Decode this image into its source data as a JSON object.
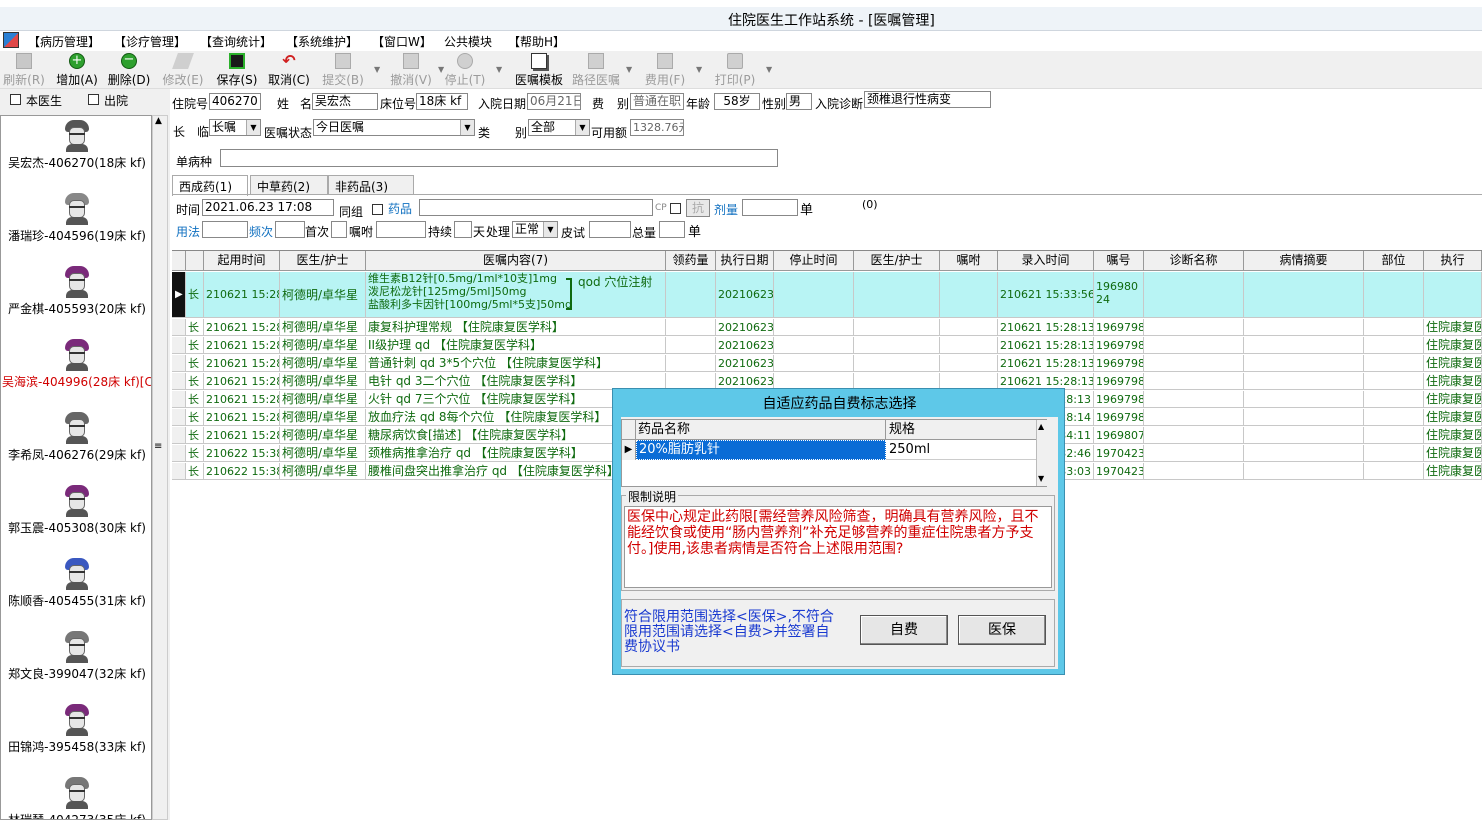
{
  "window": {
    "title": "住院医生工作站系统 - [医嘱管理]"
  },
  "menu": [
    "【病历管理】",
    "【诊疗管理】",
    "【查询统计】",
    "【系统维护】",
    "【窗口W】",
    "公共模块",
    "【帮助H】"
  ],
  "toolbar": [
    {
      "label": "刷新(R)",
      "enabled": false
    },
    {
      "label": "增加(A)",
      "enabled": true
    },
    {
      "label": "删除(D)",
      "enabled": true
    },
    {
      "label": "修改(E)",
      "enabled": false
    },
    {
      "label": "保存(S)",
      "enabled": true
    },
    {
      "label": "取消(C)",
      "enabled": true
    },
    {
      "label": "提交(B)",
      "enabled": false
    },
    {
      "label": "撤消(V)",
      "enabled": false
    },
    {
      "label": "停止(T)",
      "enabled": false
    },
    {
      "label": "医嘱模板",
      "enabled": true
    },
    {
      "label": "路径医嘱",
      "enabled": false
    },
    {
      "label": "费用(F)",
      "enabled": false
    },
    {
      "label": "打印(P)",
      "enabled": false
    }
  ],
  "left": {
    "filter_doctor": "本医生",
    "filter_discharge": "出院",
    "patients": [
      {
        "name": "吴宏杰-406270(18床 kf)",
        "highlight": false
      },
      {
        "name": "潘瑞珍-404596(19床 kf)",
        "highlight": false
      },
      {
        "name": "严金棋-405593(20床 kf)",
        "highlight": false
      },
      {
        "name": "吴海滨-404996(28床 kf)[CE",
        "highlight": true
      },
      {
        "name": "李希凤-406276(29床 kf)",
        "highlight": false
      },
      {
        "name": "郭玉震-405308(30床 kf)",
        "highlight": false
      },
      {
        "name": "陈顺香-405455(31床 kf)",
        "highlight": false
      },
      {
        "name": "郑文良-399047(32床 kf)",
        "highlight": false
      },
      {
        "name": "田锦鸿-395458(33床 kf)",
        "highlight": false
      },
      {
        "name": "林瑞琴-404273(35床 kf)",
        "highlight": false
      }
    ]
  },
  "patient": {
    "id_label": "住院号",
    "id": "406270",
    "name_label1": "姓",
    "name_label2": "名",
    "name": "吴宏杰",
    "bed_label": "床位号",
    "bed": "18床 kf",
    "admit_label": "入院日期",
    "admit": "06月21日",
    "fee_label1": "费",
    "fee_label2": "别",
    "fee": "普通在职",
    "age_label": "年龄",
    "age": "58岁",
    "sex_label": "性别",
    "sex": "男",
    "diag_label": "入院诊断",
    "diag": "颈椎退行性病变"
  },
  "order_filter": {
    "long_label": "长",
    "temp_label": "临",
    "type": "长嘱",
    "status_label": "医嘱状态",
    "status": "今日医嘱",
    "cat_label1": "类",
    "cat_label2": "别",
    "cat": "全部",
    "avail_label": "可用额",
    "avail": "1328.76元",
    "disease_label": "单病种",
    "disease": ""
  },
  "tabs": [
    "西成药(1)",
    "中草药(2)",
    "非药品(3)"
  ],
  "entry": {
    "time_label": "时间",
    "time": "2021.06.23 17:08",
    "group_label": "同组",
    "drug_label": "药品",
    "drug": "",
    "cp_label": "CP",
    "anti_label": "抗",
    "dose_label": "剂量",
    "dose": "",
    "unit_label1": "单",
    "count_marker": "(0)",
    "usage_label": "用法",
    "freq_label": "频次",
    "first_label": "首次",
    "note_label": "嘱咐",
    "dur_label": "持续",
    "days_label": "天",
    "handle_label": "处理",
    "handle": "正常",
    "skin_label": "皮试",
    "total_label": "总量",
    "unit_label2": "单"
  },
  "grid": {
    "headers": [
      "起用时间",
      "医生/护士",
      "医嘱内容(7)",
      "领药量",
      "执行日期",
      "停止时间",
      "医生/护士",
      "嘱咐",
      "录入时间",
      "嘱号",
      "诊断名称",
      "病情摘要",
      "部位",
      "执行"
    ],
    "rows": [
      {
        "type": "长",
        "start": "210621 15:28",
        "doctor": "柯德明/卓华星",
        "content": [
          "维生素B12针[0.5mg/1ml*10支]1mg",
          "泼尼松龙针[125mg/5ml]50mg",
          "盐酸利多卡因针[100mg/5ml*5支]50mg"
        ],
        "freq": "qod 穴位注射",
        "exec_date": "20210623",
        "entry_time": "210621 15:33:56",
        "no": "19698024",
        "dept": "",
        "selected": true
      },
      {
        "type": "长",
        "start": "210621 15:28",
        "doctor": "柯德明/卓华星",
        "content": [
          "康复科护理常规 【住院康复医学科】"
        ],
        "exec_date": "20210623",
        "entry_time": "210621 15:28:13",
        "no": "19697982",
        "dept": "住院康复医",
        "selected": false
      },
      {
        "type": "长",
        "start": "210621 15:28",
        "doctor": "柯德明/卓华星",
        "content": [
          "II级护理 qd 【住院康复医学科】"
        ],
        "exec_date": "20210623",
        "entry_time": "210621 15:28:13",
        "no": "19697983",
        "dept": "住院康复医",
        "selected": false
      },
      {
        "type": "长",
        "start": "210621 15:28",
        "doctor": "柯德明/卓华星",
        "content": [
          "普通针刺 qd 3*5个穴位 【住院康复医学科】"
        ],
        "exec_date": "20210623",
        "entry_time": "210621 15:28:13",
        "no": "19697985",
        "dept": "住院康复医",
        "selected": false
      },
      {
        "type": "长",
        "start": "210621 15:28",
        "doctor": "柯德明/卓华星",
        "content": [
          "电针 qd 3二个穴位 【住院康复医学科】"
        ],
        "exec_date": "20210623",
        "entry_time": "210621 15:28:13",
        "no": "19697986",
        "dept": "住院康复医",
        "selected": false
      },
      {
        "type": "长",
        "start": "210621 15:28",
        "doctor": "柯德明/卓华星",
        "content": [
          "火针 qd 7三个穴位 【住院康复医学科】"
        ],
        "exec_date": "",
        "entry_time": "28:13",
        "no": "19697988",
        "dept": "住院康复医",
        "selected": false
      },
      {
        "type": "长",
        "start": "210621 15:28",
        "doctor": "柯德明/卓华星",
        "content": [
          "放血疗法 qd 8每个穴位 【住院康复医学科】"
        ],
        "exec_date": "",
        "entry_time": "28:14",
        "no": "19697989",
        "dept": "住院康复医",
        "selected": false
      },
      {
        "type": "长",
        "start": "210621 15:28",
        "doctor": "柯德明/卓华星",
        "content": [
          "糖尿病饮食[描述] 【住院康复医学科】"
        ],
        "exec_date": "",
        "entry_time": "34:11",
        "no": "19698077",
        "dept": "住院康复医",
        "selected": false
      },
      {
        "type": "长",
        "start": "210622 15:38",
        "doctor": "柯德明/卓华星",
        "content": [
          "颈椎病推拿治疗 qd 【住院康复医学科】"
        ],
        "exec_date": "",
        "entry_time": "32:46",
        "no": "19704237",
        "dept": "住院康复医",
        "selected": false
      },
      {
        "type": "长",
        "start": "210622 15:38",
        "doctor": "柯德明/卓华星",
        "content": [
          "腰椎间盘突出推拿治疗 qd 【住院康复医学科】"
        ],
        "exec_date": "",
        "entry_time": "33:03",
        "no": "19704238",
        "dept": "住院康复医",
        "selected": false
      }
    ]
  },
  "dialog": {
    "title": "自适应药品自费标志选择",
    "col_name": "药品名称",
    "col_spec": "规格",
    "drug_name": "20%脂肪乳针",
    "drug_spec": "250ml",
    "limit_title": "限制说明",
    "limit_text": "医保中心规定此药限[需经营养风险筛查，明确具有营养风险，且不能经饮食或使用“肠内营养剂”补充足够营养的重症住院患者方予支付。]使用,该患者病情是否符合上述限用范围?",
    "hint": "符合限用范围选择<医保>,不符合限用范围请选择<自费>并签署自费协议书",
    "btn_self": "自费",
    "btn_insurance": "医保"
  },
  "colors": {
    "selected_row": "#b8f4f4",
    "dialog_bg": "#5ec8e8",
    "green_text": "#0f6a0f",
    "red_text": "#d00000",
    "blue_text": "#1a3ad0"
  }
}
